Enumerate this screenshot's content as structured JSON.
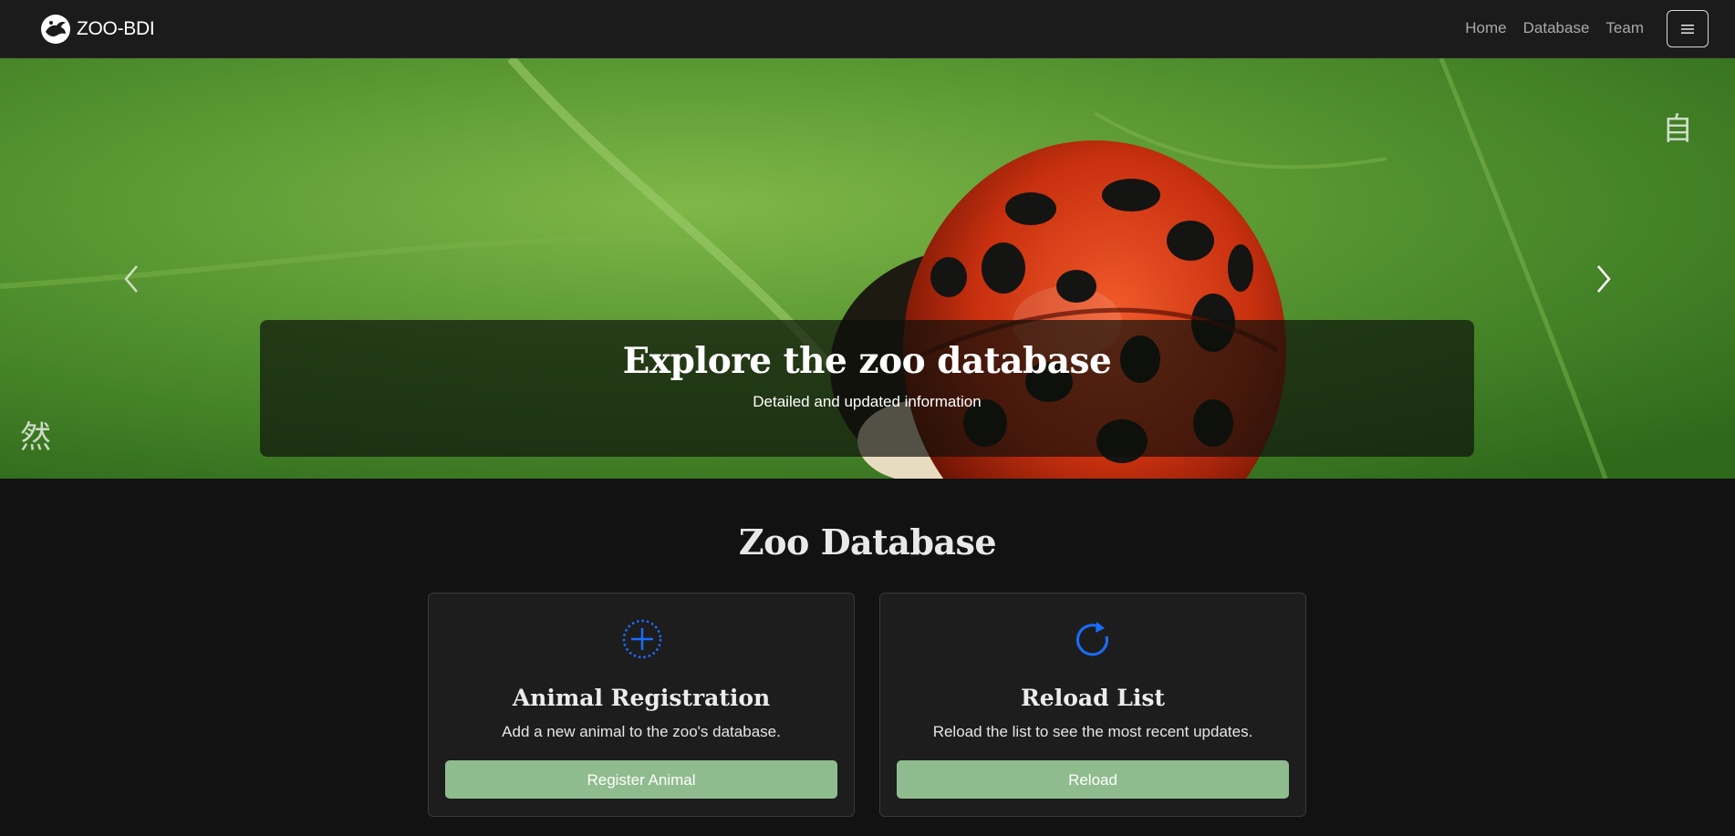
{
  "navbar": {
    "brand": "ZOO-BDI",
    "links": [
      "Home",
      "Database",
      "Team"
    ],
    "toggle_icon": "hamburger-icon"
  },
  "hero": {
    "title": "Explore the zoo database",
    "subtitle": "Detailed and updated information",
    "kanji_top": "自",
    "kanji_bottom": "然",
    "prev_icon": "chevron-left-icon",
    "next_icon": "chevron-right-icon"
  },
  "section": {
    "title": "Zoo Database"
  },
  "cards": [
    {
      "icon": "plus-circle-icon",
      "title": "Animal Registration",
      "text": "Add a new animal to the zoo's database.",
      "button": "Register Animal"
    },
    {
      "icon": "reload-icon",
      "title": "Reload List",
      "text": "Reload the list to see the most recent updates.",
      "button": "Reload"
    }
  ],
  "colors": {
    "background": "#121212",
    "navbar": "#1b1b1b",
    "card": "#1d1d1d",
    "button": "#8fbc8f",
    "icon_accent": "#1a6dff"
  }
}
